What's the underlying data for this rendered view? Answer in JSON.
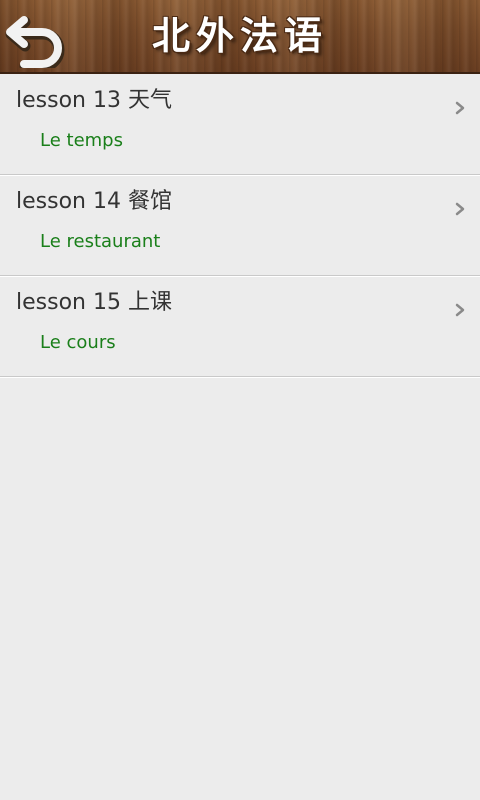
{
  "header": {
    "title": "北外法语",
    "back_icon": "back-arrow-icon"
  },
  "lessons": [
    {
      "title": "lesson 13 天气",
      "subtitle": "Le temps"
    },
    {
      "title": "lesson 14 餐馆",
      "subtitle": "Le restaurant"
    },
    {
      "title": "lesson 15 上课",
      "subtitle": "Le cours"
    }
  ],
  "colors": {
    "title_bar": "#7a4c2a",
    "subtitle_text": "#1a7f1a",
    "title_text": "#333333",
    "background": "#ececec"
  }
}
